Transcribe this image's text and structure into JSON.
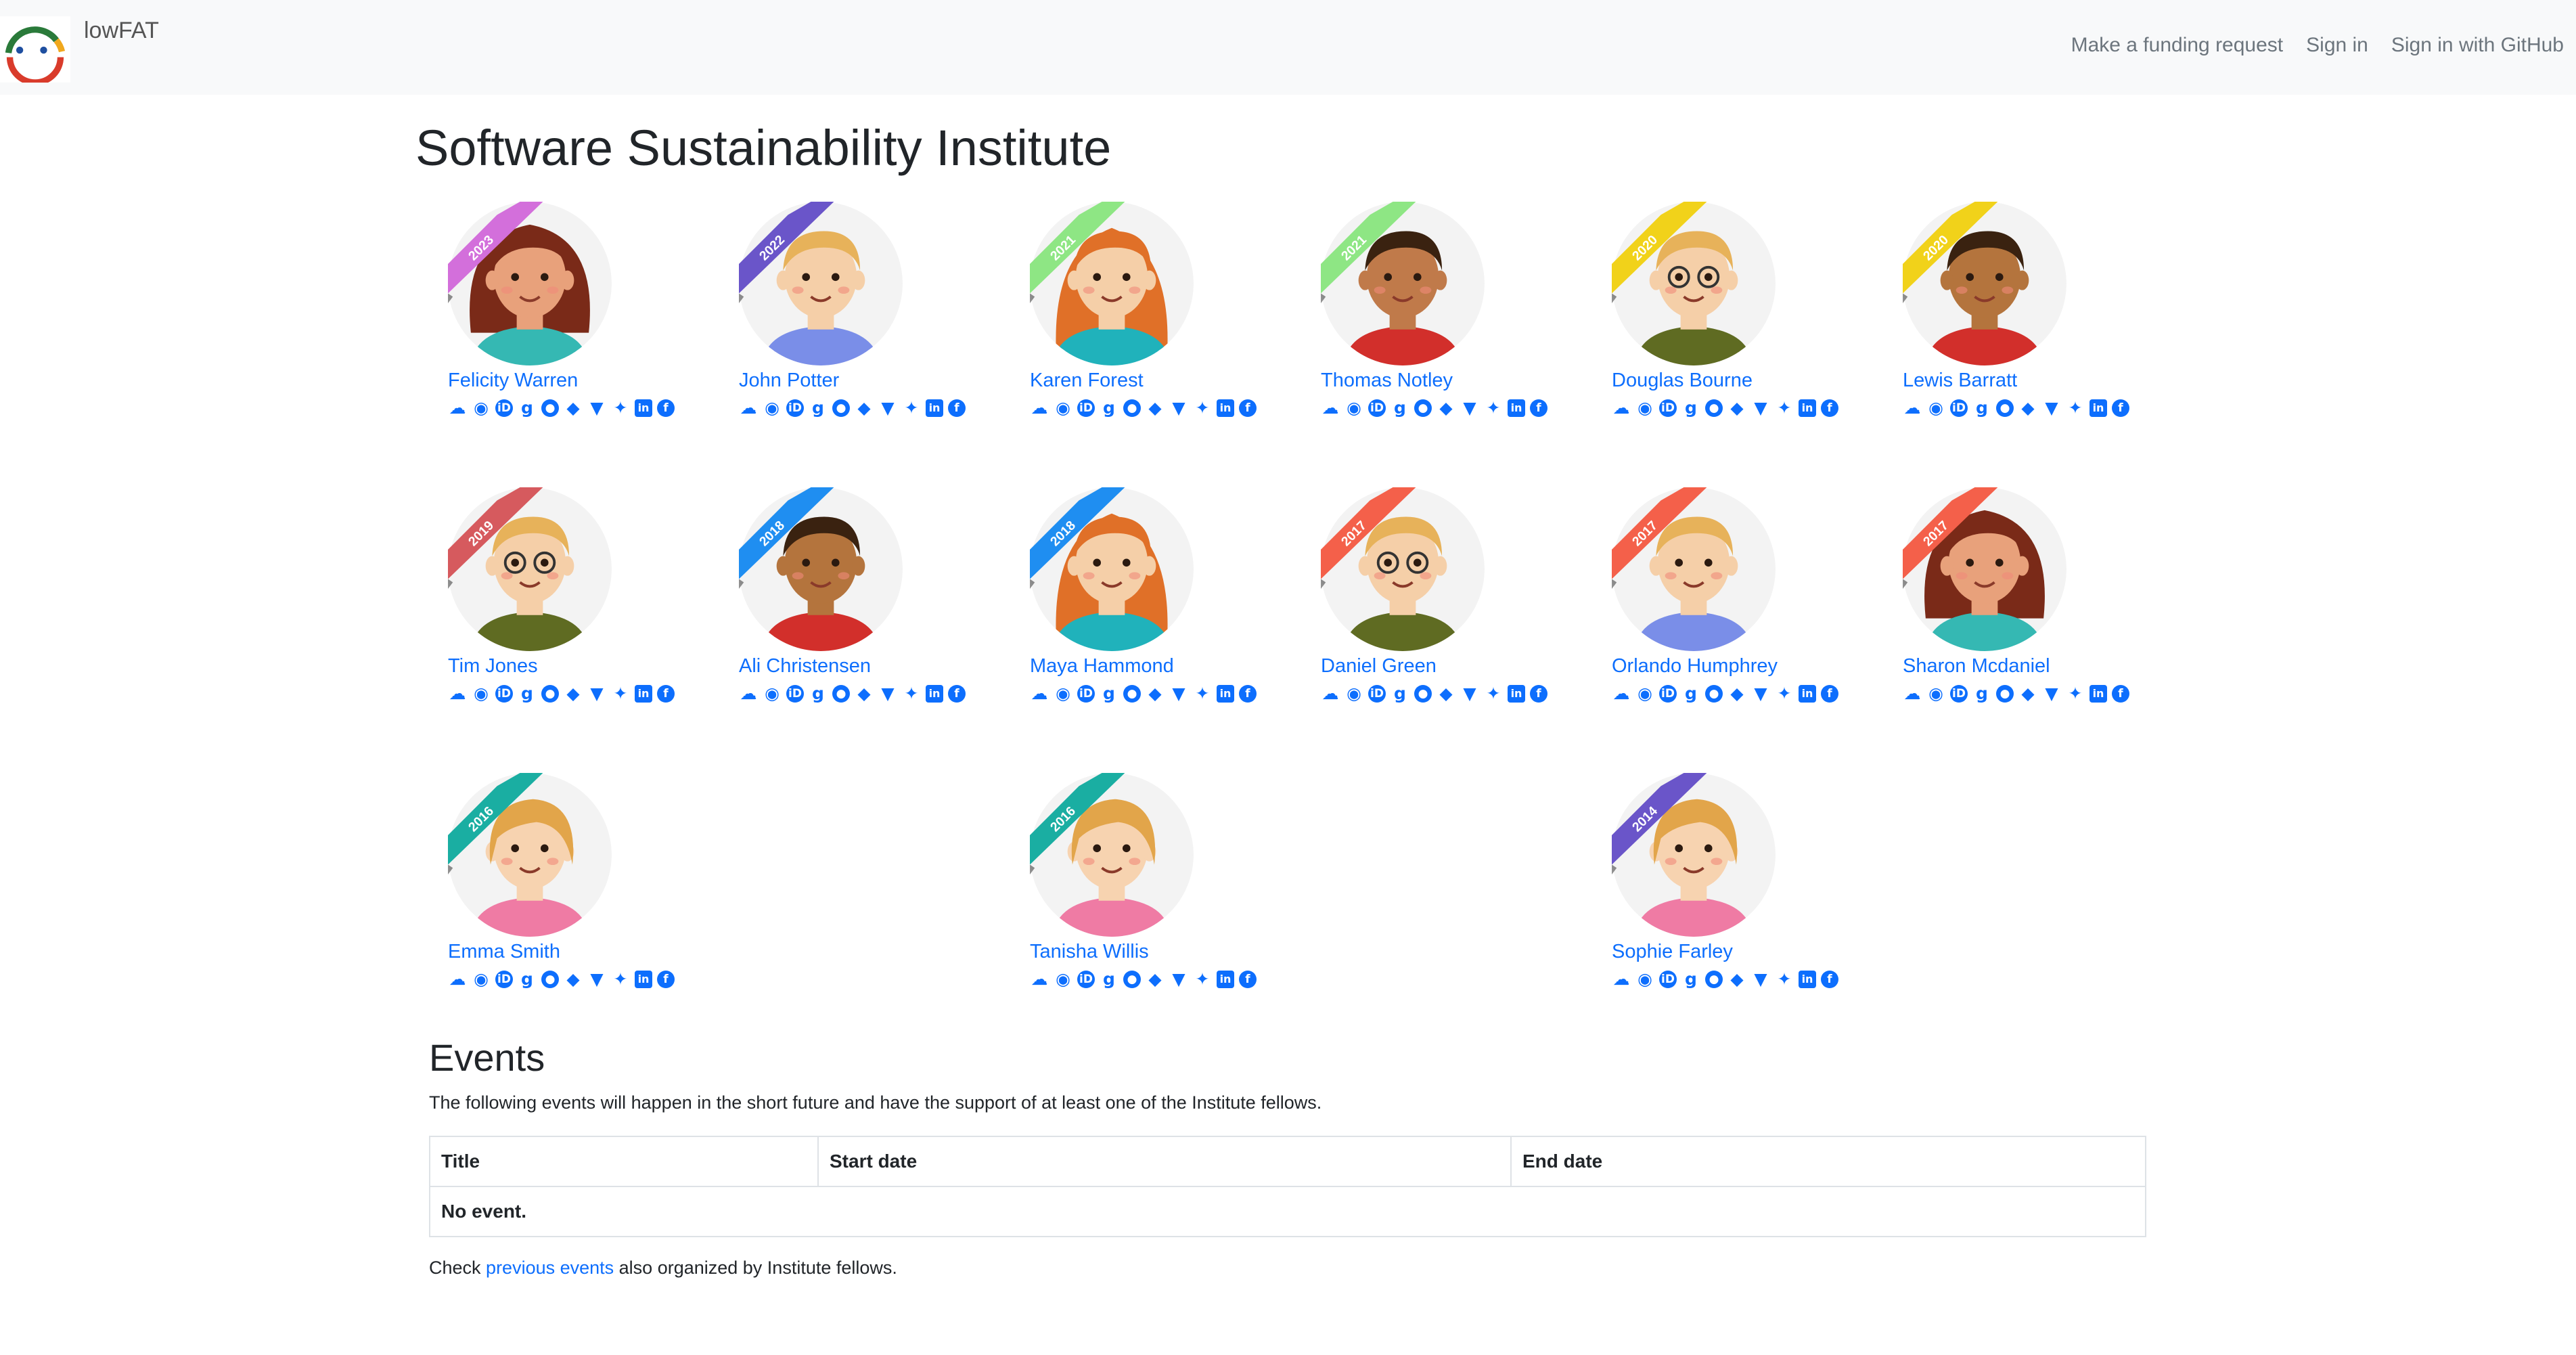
{
  "navbar": {
    "brand": "lowFAT",
    "links": [
      "Make a funding request",
      "Sign in",
      "Sign in with GitHub"
    ]
  },
  "page_title": "Software Sustainability Institute",
  "social_icons": [
    "cloud-icon",
    "rss-icon",
    "orcid-icon",
    "google-scholar-icon",
    "github-icon",
    "gitlab-icon",
    "bitbucket-icon",
    "twitter-icon",
    "linkedin-icon",
    "facebook-icon"
  ],
  "fellows": [
    {
      "name": "Felicity Warren",
      "year": "2023",
      "ribbon": "#d36fdb",
      "skin": "#e8a17b",
      "hair": "#7a2a18",
      "shirt": "#35b8b3",
      "style": "curly"
    },
    {
      "name": "John Potter",
      "year": "2022",
      "ribbon": "#6a55c9",
      "skin": "#f5cfa8",
      "hair": "#e7b25a",
      "shirt": "#7a8ee8",
      "style": "short"
    },
    {
      "name": "Karen Forest",
      "year": "2021",
      "ribbon": "#8ee684",
      "skin": "#f5cfa8",
      "hair": "#e07028",
      "shirt": "#20b2bb",
      "style": "long"
    },
    {
      "name": "Thomas Notley",
      "year": "2021",
      "ribbon": "#8ee684",
      "skin": "#c07a4a",
      "hair": "#3a2210",
      "shirt": "#d22f2b",
      "style": "short"
    },
    {
      "name": "Douglas Bourne",
      "year": "2020",
      "ribbon": "#f1d21a",
      "skin": "#f5cfa8",
      "hair": "#e7b25a",
      "shirt": "#5f6b22",
      "style": "glasses"
    },
    {
      "name": "Lewis Barratt",
      "year": "2020",
      "ribbon": "#f1d21a",
      "skin": "#b4743d",
      "hair": "#3a2210",
      "shirt": "#d22f2b",
      "style": "short"
    },
    {
      "name": "Tim Jones",
      "year": "2019",
      "ribbon": "#d65a5e",
      "skin": "#f5cfa8",
      "hair": "#e7b25a",
      "shirt": "#5f6b22",
      "style": "glasses"
    },
    {
      "name": "Ali Christensen",
      "year": "2018",
      "ribbon": "#1f8ef1",
      "skin": "#b4743d",
      "hair": "#3a2210",
      "shirt": "#d22f2b",
      "style": "short"
    },
    {
      "name": "Maya Hammond",
      "year": "2018",
      "ribbon": "#1f8ef1",
      "skin": "#f5cfa8",
      "hair": "#e07028",
      "shirt": "#20b2bb",
      "style": "long"
    },
    {
      "name": "Daniel Green",
      "year": "2017",
      "ribbon": "#f4604a",
      "skin": "#f5cfa8",
      "hair": "#e7b25a",
      "shirt": "#5f6b22",
      "style": "glasses"
    },
    {
      "name": "Orlando Humphrey",
      "year": "2017",
      "ribbon": "#f4604a",
      "skin": "#f5cfa8",
      "hair": "#e7b25a",
      "shirt": "#7a8ee8",
      "style": "short"
    },
    {
      "name": "Sharon Mcdaniel",
      "year": "2017",
      "ribbon": "#f4604a",
      "skin": "#e8a17b",
      "hair": "#7a2a18",
      "shirt": "#35b8b3",
      "style": "curly"
    },
    {
      "name": "Emma Smith",
      "year": "2016",
      "ribbon": "#1aaea2",
      "skin": "#f7d3b0",
      "hair": "#e2a54a",
      "shirt": "#ef7ba4",
      "style": "bob"
    },
    {
      "name": "Tanisha Willis",
      "year": "2016",
      "ribbon": "#1aaea2",
      "skin": "#f7d3b0",
      "hair": "#e2a54a",
      "shirt": "#ef7ba4",
      "style": "bob"
    },
    {
      "name": "Sophie Farley",
      "year": "2014",
      "ribbon": "#6a55c9",
      "skin": "#f7d3b0",
      "hair": "#e2a54a",
      "shirt": "#ef7ba4",
      "style": "bob"
    }
  ],
  "events": {
    "title": "Events",
    "description": "The following events will happen in the short future and have the support of at least one of the Institute fellows.",
    "columns": [
      "Title",
      "Start date",
      "End date"
    ],
    "empty": "No event.",
    "footer_prefix": "Check ",
    "footer_link": "previous events",
    "footer_suffix": " also organized by Institute fellows."
  }
}
